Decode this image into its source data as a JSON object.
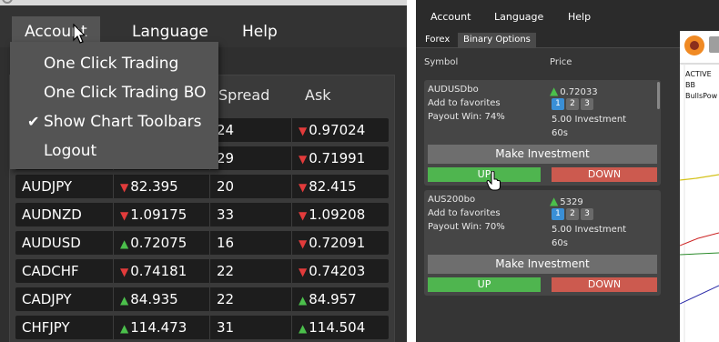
{
  "left_window": {
    "menubar": [
      "Account",
      "Language",
      "Help"
    ],
    "account_menu": {
      "items": [
        {
          "label": "One Click Trading",
          "checked": false
        },
        {
          "label": "One Click Trading BO",
          "checked": false
        },
        {
          "label": "Show Chart Toolbars",
          "checked": true
        },
        {
          "label": "Logout",
          "checked": false
        }
      ]
    },
    "quotes_table": {
      "visible_headers": {
        "spread": "Spread",
        "ask": "Ask"
      },
      "rows": [
        {
          "symbol": "",
          "bid": "",
          "bid_dir": "",
          "spread": "24",
          "ask": "0.97024",
          "ask_dir": "down"
        },
        {
          "symbol": "",
          "bid": "",
          "bid_dir": "",
          "spread": "29",
          "ask": "0.71991",
          "ask_dir": "down"
        },
        {
          "symbol": "AUDJPY",
          "bid": "82.395",
          "bid_dir": "down",
          "spread": "20",
          "ask": "82.415",
          "ask_dir": "down"
        },
        {
          "symbol": "AUDNZD",
          "bid": "1.09175",
          "bid_dir": "down",
          "spread": "33",
          "ask": "1.09208",
          "ask_dir": "down"
        },
        {
          "symbol": "AUDUSD",
          "bid": "0.72075",
          "bid_dir": "up",
          "spread": "16",
          "ask": "0.72091",
          "ask_dir": "down"
        },
        {
          "symbol": "CADCHF",
          "bid": "0.74181",
          "bid_dir": "down",
          "spread": "22",
          "ask": "0.74203",
          "ask_dir": "down"
        },
        {
          "symbol": "CADJPY",
          "bid": "84.935",
          "bid_dir": "up",
          "spread": "22",
          "ask": "84.957",
          "ask_dir": "up"
        },
        {
          "symbol": "CHFJPY",
          "bid": "114.473",
          "bid_dir": "up",
          "spread": "31",
          "ask": "114.504",
          "ask_dir": "up"
        }
      ]
    }
  },
  "right_window": {
    "menubar": [
      "Account",
      "Language",
      "Help"
    ],
    "tabs": [
      {
        "label": "Forex",
        "selected": false
      },
      {
        "label": "Binary Options",
        "selected": true
      }
    ],
    "columns": {
      "symbol": "Symbol",
      "price": "Price"
    },
    "options": [
      {
        "symbol": "AUDUSDbo",
        "price": "0.72033",
        "price_dir": "up",
        "favorites": "Add to favorites",
        "payout": "Payout Win: 74%",
        "investment": "5.00 Investment",
        "duration": "60s",
        "expiry_choices": [
          "1",
          "2",
          "3"
        ],
        "selected_choice": "1",
        "make_label": "Make Investment",
        "up_label": "UP",
        "down_label": "DOWN"
      },
      {
        "symbol": "AUS200bo",
        "price": "5329",
        "price_dir": "up",
        "favorites": "Add to favorites",
        "payout": "Payout Win: 70%",
        "investment": "5.00 Investment",
        "duration": "60s",
        "expiry_choices": [
          "1",
          "2",
          "3"
        ],
        "selected_choice": "1",
        "make_label": "Make Investment",
        "up_label": "UP",
        "down_label": "DOWN"
      }
    ],
    "chart_labels": [
      "ACTIVE",
      "BB",
      "BullsPow"
    ]
  },
  "colors": {
    "up": "#4bbf4b",
    "down": "#e23b3b",
    "up_button": "#4fb54f",
    "down_button": "#cc5a4f",
    "selected_choice": "#3a8fd6"
  },
  "icons": [
    "arrow-cursor-icon",
    "hand-cursor-icon",
    "checkmark-icon",
    "triangle-up-icon",
    "triangle-down-icon",
    "app-logo-icon"
  ]
}
